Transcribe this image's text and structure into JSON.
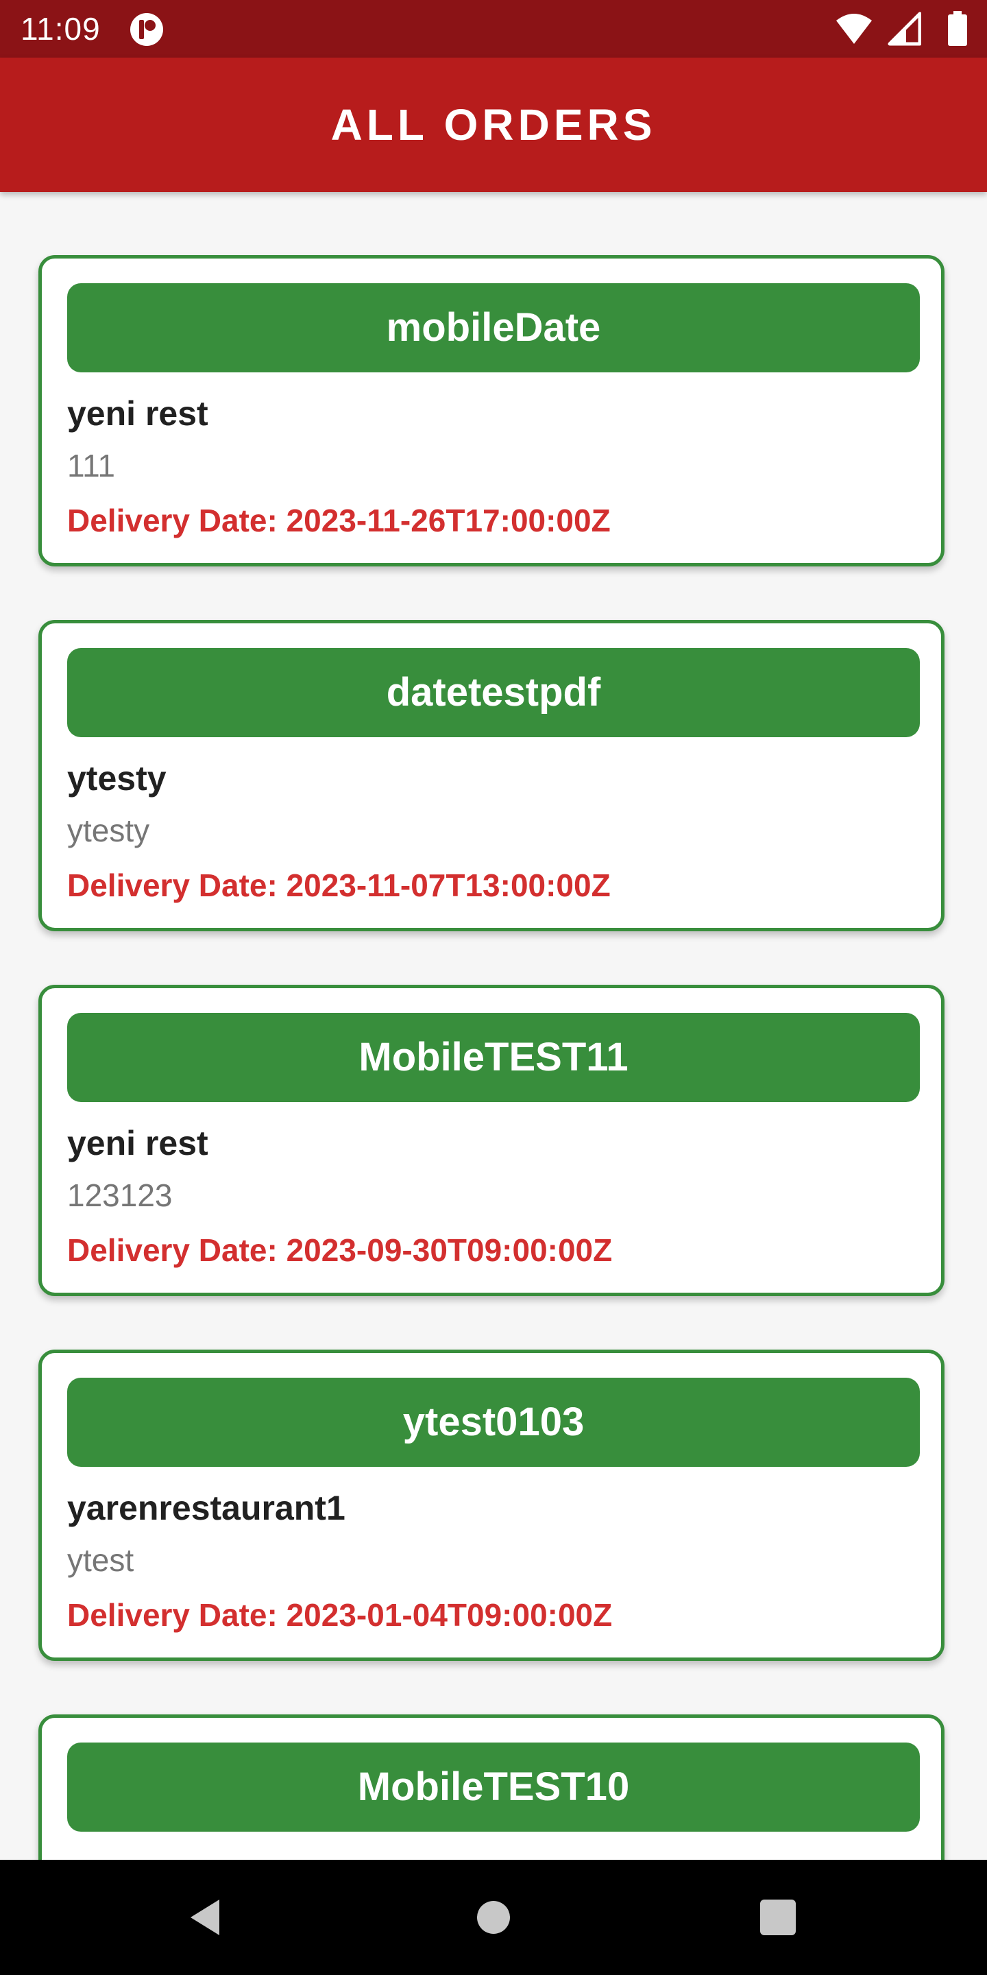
{
  "status_bar": {
    "time": "11:09",
    "app_icon": "notification-app-icon",
    "icons": [
      "wifi-icon",
      "signal-icon",
      "battery-icon"
    ]
  },
  "header": {
    "title": "ALL ORDERS"
  },
  "orders": [
    {
      "name": "mobileDate",
      "restaurant": "yeni rest",
      "note": "111",
      "delivery": "Delivery Date: 2023-11-26T17:00:00Z"
    },
    {
      "name": "datetestpdf",
      "restaurant": "ytesty",
      "note": "ytesty",
      "delivery": "Delivery Date: 2023-11-07T13:00:00Z"
    },
    {
      "name": "MobileTEST11",
      "restaurant": "yeni rest",
      "note": "123123",
      "delivery": "Delivery Date: 2023-09-30T09:00:00Z"
    },
    {
      "name": "ytest0103",
      "restaurant": "yarenrestaurant1",
      "note": "ytest",
      "delivery": "Delivery Date: 2023-01-04T09:00:00Z"
    },
    {
      "name": "MobileTEST10"
    }
  ],
  "navigation": {
    "buttons": [
      "back-icon",
      "home-icon",
      "recents-icon"
    ]
  },
  "colors": {
    "status_bar": "#8b1316",
    "app_bar": "#b71c1c",
    "card_border": "#388e3c",
    "card_header": "#388e3c",
    "delivery_text": "#d32f2f",
    "note_text": "#767676",
    "background": "#f6f6f6"
  }
}
